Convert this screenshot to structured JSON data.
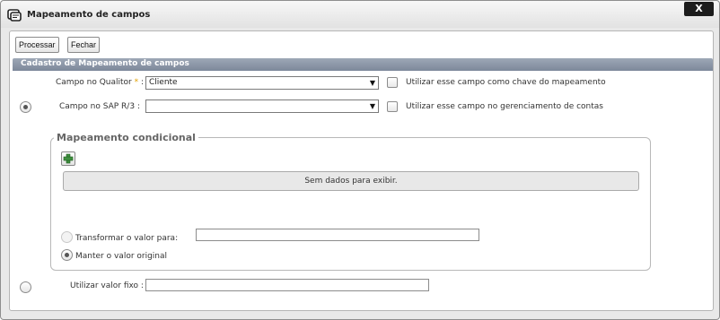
{
  "window": {
    "title": "Mapeamento de campos",
    "close_label": "X"
  },
  "toolbar": {
    "process_label": "Processar",
    "close_label": "Fechar"
  },
  "section": {
    "title": "Cadastro de Mapeamento de campos"
  },
  "form": {
    "qualitor_field": {
      "label": "Campo no Qualitor",
      "required_mark": "*",
      "suffix": ":",
      "value": "Cliente",
      "key_checkbox_label": "Utilizar esse campo como chave do mapeamento",
      "key_checkbox_checked": false
    },
    "sap_field": {
      "label": "Campo no SAP R/3",
      "suffix": ":",
      "value": "",
      "accounts_checkbox_label": "Utilizar esse campo no gerenciamento de contas",
      "accounts_checkbox_checked": false,
      "radio_selected": true
    },
    "conditional": {
      "legend": "Mapeamento condicional",
      "add_icon": "plus-icon",
      "empty_message": "Sem dados para exibir.",
      "transform_label": "Transformar o valor para:",
      "transform_value": "",
      "transform_disabled": true,
      "keep_label": "Manter o valor original",
      "keep_selected": true
    },
    "fixed_value": {
      "label": "Utilizar valor fixo :",
      "value": "",
      "radio_selected": false
    }
  }
}
